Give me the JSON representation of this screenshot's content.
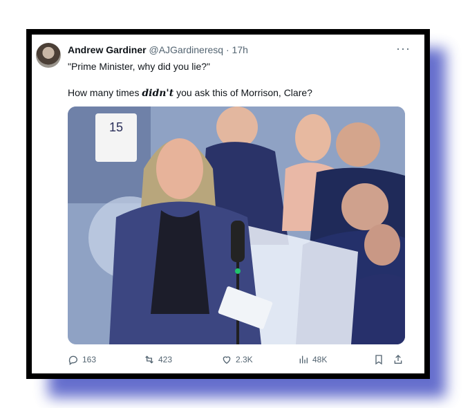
{
  "tweet": {
    "author_name": "Andrew Gardiner",
    "handle": "@AJGardineresq",
    "separator": "·",
    "time": "17h",
    "more_label": "···",
    "line1": "\"Prime Minister, why did you lie?\"",
    "line2_pre": "How many times ",
    "line2_emph": "didn't",
    "line2_post": " you ask this of Morrison, Clare?"
  },
  "photo": {
    "table_number": "15"
  },
  "actions": {
    "replies": "163",
    "reposts": "423",
    "likes": "2.3K",
    "views": "48K"
  },
  "colors": {
    "frame": "#000000",
    "shadow": "#4a55c4",
    "text": "#0f1419",
    "muted": "#536471"
  }
}
